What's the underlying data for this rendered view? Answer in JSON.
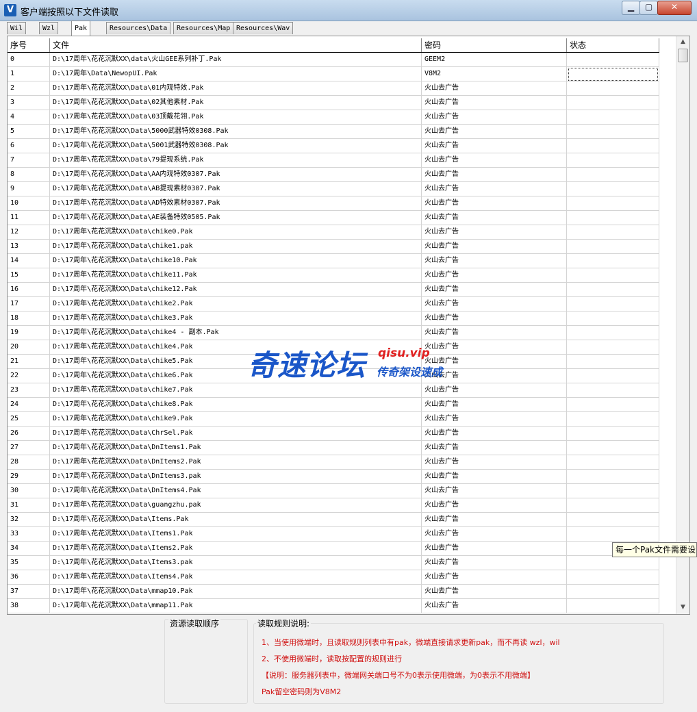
{
  "window": {
    "title": "客户端按照以下文件读取",
    "icon_letter": "V",
    "btn_min": "▁",
    "btn_max": "▢",
    "btn_close": "✕"
  },
  "tabs": [
    "Wil",
    "Wzl",
    "Pak",
    "Resources\\Data",
    "Resources\\Map",
    "Resources\\Wav"
  ],
  "active_tab": "Pak",
  "table": {
    "headers": [
      "序号",
      "文件",
      "密码",
      "状态"
    ],
    "rows": [
      [
        "0",
        "D:\\17周年\\花花沉默XX\\data\\火山GEE系列补丁.Pak",
        "GEEM2",
        ""
      ],
      [
        "1",
        "D:\\17周年\\Data\\NewopUI.Pak",
        "V8M2",
        ""
      ],
      [
        "2",
        "D:\\17周年\\花花沉默XX\\Data\\01内观特效.Pak",
        "火山去广告",
        ""
      ],
      [
        "3",
        "D:\\17周年\\花花沉默XX\\Data\\02其他素材.Pak",
        "火山去广告",
        ""
      ],
      [
        "4",
        "D:\\17周年\\花花沉默XX\\Data\\03顶戴花翎.Pak",
        "火山去广告",
        ""
      ],
      [
        "5",
        "D:\\17周年\\花花沉默XX\\Data\\5000武器特效0308.Pak",
        "火山去广告",
        ""
      ],
      [
        "6",
        "D:\\17周年\\花花沉默XX\\Data\\5001武器特效0308.Pak",
        "火山去广告",
        ""
      ],
      [
        "7",
        "D:\\17周年\\花花沉默XX\\Data\\79提现系统.Pak",
        "火山去广告",
        ""
      ],
      [
        "8",
        "D:\\17周年\\花花沉默XX\\Data\\AA内观特效0307.Pak",
        "火山去广告",
        ""
      ],
      [
        "9",
        "D:\\17周年\\花花沉默XX\\Data\\AB提现素材0307.Pak",
        "火山去广告",
        ""
      ],
      [
        "10",
        "D:\\17周年\\花花沉默XX\\Data\\AD特效素材0307.Pak",
        "火山去广告",
        ""
      ],
      [
        "11",
        "D:\\17周年\\花花沉默XX\\Data\\AE装备特效0505.Pak",
        "火山去广告",
        ""
      ],
      [
        "12",
        "D:\\17周年\\花花沉默XX\\Data\\chike0.Pak",
        "火山去广告",
        ""
      ],
      [
        "13",
        "D:\\17周年\\花花沉默XX\\Data\\chike1.pak",
        "火山去广告",
        ""
      ],
      [
        "14",
        "D:\\17周年\\花花沉默XX\\Data\\chike10.Pak",
        "火山去广告",
        ""
      ],
      [
        "15",
        "D:\\17周年\\花花沉默XX\\Data\\chike11.Pak",
        "火山去广告",
        ""
      ],
      [
        "16",
        "D:\\17周年\\花花沉默XX\\Data\\chike12.Pak",
        "火山去广告",
        ""
      ],
      [
        "17",
        "D:\\17周年\\花花沉默XX\\Data\\chike2.Pak",
        "火山去广告",
        ""
      ],
      [
        "18",
        "D:\\17周年\\花花沉默XX\\Data\\chike3.Pak",
        "火山去广告",
        ""
      ],
      [
        "19",
        "D:\\17周年\\花花沉默XX\\Data\\chike4 - 副本.Pak",
        "火山去广告",
        ""
      ],
      [
        "20",
        "D:\\17周年\\花花沉默XX\\Data\\chike4.Pak",
        "火山去广告",
        ""
      ],
      [
        "21",
        "D:\\17周年\\花花沉默XX\\Data\\chike5.Pak",
        "火山去广告",
        ""
      ],
      [
        "22",
        "D:\\17周年\\花花沉默XX\\Data\\chike6.Pak",
        "火山去广告",
        ""
      ],
      [
        "23",
        "D:\\17周年\\花花沉默XX\\Data\\chike7.Pak",
        "火山去广告",
        ""
      ],
      [
        "24",
        "D:\\17周年\\花花沉默XX\\Data\\chike8.Pak",
        "火山去广告",
        ""
      ],
      [
        "25",
        "D:\\17周年\\花花沉默XX\\Data\\chike9.Pak",
        "火山去广告",
        ""
      ],
      [
        "26",
        "D:\\17周年\\花花沉默XX\\Data\\ChrSel.Pak",
        "火山去广告",
        ""
      ],
      [
        "27",
        "D:\\17周年\\花花沉默XX\\Data\\DnItems1.Pak",
        "火山去广告",
        ""
      ],
      [
        "28",
        "D:\\17周年\\花花沉默XX\\Data\\DnItems2.Pak",
        "火山去广告",
        ""
      ],
      [
        "29",
        "D:\\17周年\\花花沉默XX\\Data\\DnItems3.pak",
        "火山去广告",
        ""
      ],
      [
        "30",
        "D:\\17周年\\花花沉默XX\\Data\\DnItems4.Pak",
        "火山去广告",
        ""
      ],
      [
        "31",
        "D:\\17周年\\花花沉默XX\\Data\\guangzhu.pak",
        "火山去广告",
        ""
      ],
      [
        "32",
        "D:\\17周年\\花花沉默XX\\Data\\Items.Pak",
        "火山去广告",
        ""
      ],
      [
        "33",
        "D:\\17周年\\花花沉默XX\\Data\\Items1.Pak",
        "火山去广告",
        ""
      ],
      [
        "34",
        "D:\\17周年\\花花沉默XX\\Data\\Items2.Pak",
        "火山去广告",
        ""
      ],
      [
        "35",
        "D:\\17周年\\花花沉默XX\\Data\\Items3.pak",
        "火山去广告",
        ""
      ],
      [
        "36",
        "D:\\17周年\\花花沉默XX\\Data\\Items4.Pak",
        "火山去广告",
        ""
      ],
      [
        "37",
        "D:\\17周年\\花花沉默XX\\Data\\mmap10.Pak",
        "火山去广告",
        ""
      ],
      [
        "38",
        "D:\\17周年\\花花沉默XX\\Data\\mmap11.Pak",
        "火山去广告",
        ""
      ]
    ]
  },
  "scrollbar": {
    "up": "▲",
    "down": "▼"
  },
  "tooltip": "每一个Pak文件需要设",
  "watermark": {
    "main": "奇速论坛",
    "url": "qisu.vip",
    "sub": "传奇架设速成"
  },
  "bottom": {
    "order_label": "资源读取顺序",
    "rules_label": "读取规则说明:",
    "notes": [
      "1、当使用微端时，且读取规则列表中有pak，微端直接请求更新pak，而不再读 wzl，wil",
      "2、不使用微端时，读取按配置的规则进行",
      "【说明：服务器列表中，微端网关端口号不为0表示使用微端，为0表示不用微端】",
      "Pak留空密码则为V8M2"
    ]
  }
}
